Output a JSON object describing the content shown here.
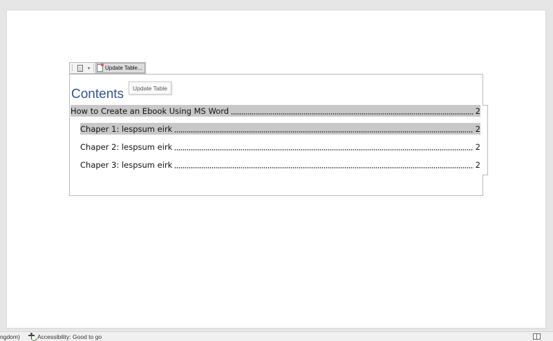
{
  "toc_toolbar": {
    "grip_icon": "vertical-grip-icon",
    "toc_icon": "table-of-contents-icon",
    "menu_caret_icon": "chevron-down-icon",
    "update_icon": "update-table-icon",
    "update_label": "Update Table..."
  },
  "tooltip": {
    "text": "Update Table"
  },
  "toc": {
    "heading": "Contents",
    "heading_color": "#2f5496",
    "highlight_color": "#c8c8c8",
    "entries": [
      {
        "text": "How to Create an Ebook Using MS Word",
        "page": "2",
        "level": 1,
        "highlighted": true
      },
      {
        "text": "Chaper 1: lespsum eirk",
        "page": "2",
        "level": 2,
        "highlighted": true
      },
      {
        "text": "Chaper 2: lespsum eirk",
        "page": "2",
        "level": 2,
        "highlighted": false
      },
      {
        "text": "Chaper 3: lespsum eirk",
        "page": "2",
        "level": 2,
        "highlighted": false
      }
    ]
  },
  "status_bar": {
    "language": "ngdom)",
    "accessibility_icon": "accessibility-check-icon",
    "accessibility": "Accessibility: Good to go",
    "view_icon": "read-mode-icon"
  }
}
